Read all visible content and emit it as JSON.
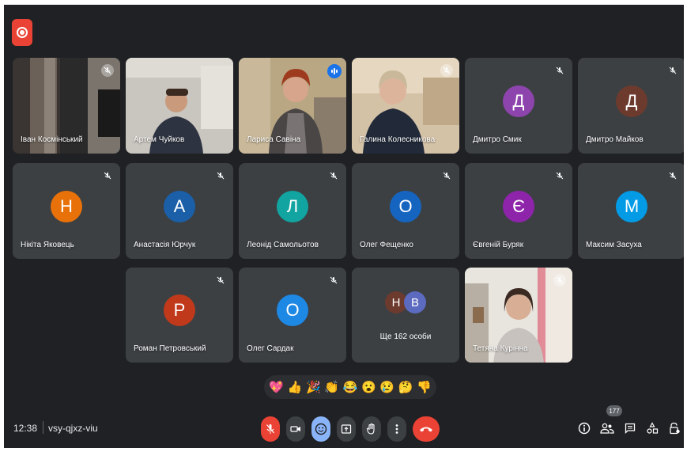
{
  "meeting": {
    "time": "12:38",
    "code": "vsy-qjxz-viu"
  },
  "participants": [
    {
      "name": "Іван Космінський"
    },
    {
      "name": "Артем Чуйков"
    },
    {
      "name": "Лариса Савіна"
    },
    {
      "name": "Галина Колесникова"
    },
    {
      "name": "Дмитро Смик",
      "initial": "Д",
      "color": "#8e44ad"
    },
    {
      "name": "Дмитро Майков",
      "initial": "Д",
      "color": "#6d3a2e"
    },
    {
      "name": "Нікіта Яковець",
      "initial": "Н",
      "color": "#e8710a"
    },
    {
      "name": "Анастасія Юрчук",
      "initial": "А",
      "color": "#1a5fa8"
    },
    {
      "name": "Леонід Самольотов",
      "initial": "Л",
      "color": "#12a4a1"
    },
    {
      "name": "Олег Фещенко",
      "initial": "О",
      "color": "#1565c0"
    },
    {
      "name": "Євгеній Буряк",
      "initial": "Є",
      "color": "#8e24aa"
    },
    {
      "name": "Максим Засуха",
      "initial": "М",
      "color": "#039be5"
    },
    {
      "name": "Роман Петровський",
      "initial": "Р",
      "color": "#c0391b"
    },
    {
      "name": "Олег Сардак",
      "initial": "О",
      "color": "#1e88e5"
    },
    {
      "name": "Тетяна Курінна"
    }
  ],
  "others": {
    "label": "Ще 162 особи",
    "initials": [
      "Н",
      "В"
    ],
    "colors": [
      "#6d3a2e",
      "#5c6bc0"
    ]
  },
  "reactions": [
    "💖",
    "👍",
    "🎉",
    "👏",
    "😂",
    "😮",
    "😢",
    "🤔",
    "👎"
  ],
  "people_count": "177",
  "colors": {
    "accent": "#8ab4f8",
    "end_call": "#ea4335",
    "background": "#202124"
  },
  "icons": [
    "record-icon",
    "mic-off-icon",
    "camera-icon",
    "emoji-icon",
    "present-icon",
    "raise-hand-icon",
    "more-options-icon",
    "end-call-icon",
    "info-icon",
    "people-icon",
    "chat-icon",
    "activities-icon",
    "host-controls-icon"
  ]
}
